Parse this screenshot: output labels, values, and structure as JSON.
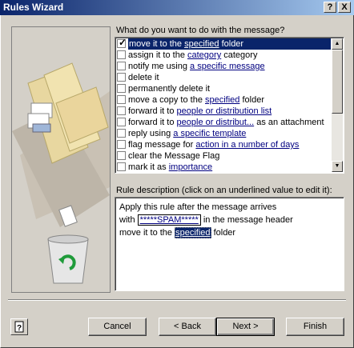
{
  "window": {
    "title": "Rules Wizard",
    "help_glyph": "?",
    "close_glyph": "X"
  },
  "actions_prompt": "What do you want to do with the message?",
  "actions": [
    {
      "checked": true,
      "selected": true,
      "pre": "move it to the ",
      "link": "specified",
      "post": " folder"
    },
    {
      "checked": false,
      "selected": false,
      "pre": "assign it to the ",
      "link": "category",
      "post": " category"
    },
    {
      "checked": false,
      "selected": false,
      "pre": "notify me using ",
      "link": "a specific message",
      "post": ""
    },
    {
      "checked": false,
      "selected": false,
      "pre": "delete it",
      "link": "",
      "post": ""
    },
    {
      "checked": false,
      "selected": false,
      "pre": "permanently delete it",
      "link": "",
      "post": ""
    },
    {
      "checked": false,
      "selected": false,
      "pre": "move a copy to the ",
      "link": "specified",
      "post": " folder"
    },
    {
      "checked": false,
      "selected": false,
      "pre": "forward it to ",
      "link": "people or distribution list",
      "post": ""
    },
    {
      "checked": false,
      "selected": false,
      "pre": "forward it to ",
      "link": "people or distribut...",
      "post": " as an attachment"
    },
    {
      "checked": false,
      "selected": false,
      "pre": "reply using ",
      "link": "a specific template",
      "post": ""
    },
    {
      "checked": false,
      "selected": false,
      "pre": "flag message for ",
      "link": "action in a number of days",
      "post": ""
    },
    {
      "checked": false,
      "selected": false,
      "pre": "clear the Message Flag",
      "link": "",
      "post": ""
    },
    {
      "checked": false,
      "selected": false,
      "pre": "mark it as ",
      "link": "importance",
      "post": ""
    }
  ],
  "description_label": "Rule description (click on an underlined value to edit it):",
  "description": {
    "line1": "Apply this rule after the message arrives",
    "line2_pre": "with ",
    "line2_value": "*****SPAM*****",
    "line2_post": " in the message header",
    "line3_pre": "move it to the ",
    "line3_link": "specified",
    "line3_post": " folder"
  },
  "buttons": {
    "cancel": "Cancel",
    "back": "< Back",
    "next": "Next >",
    "finish": "Finish"
  },
  "icons": {
    "help": "help-question-icon",
    "illustration": "folders-recycle-bin-illustration"
  }
}
